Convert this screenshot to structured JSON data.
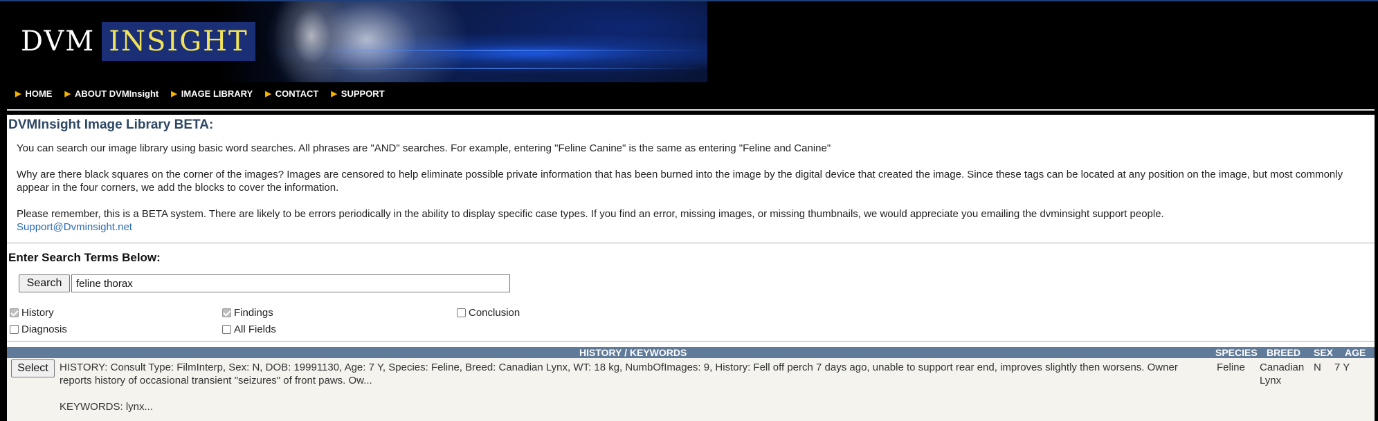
{
  "banner": {
    "logo_left": "DVM",
    "logo_right": "INSIGHT"
  },
  "nav": {
    "items": [
      {
        "label": "HOME"
      },
      {
        "label": "ABOUT DVMInsight"
      },
      {
        "label": "IMAGE LIBRARY"
      },
      {
        "label": "CONTACT"
      },
      {
        "label": "SUPPORT"
      }
    ]
  },
  "library": {
    "title": "DVMInsight Image Library BETA:",
    "para1": "You can search our image library using basic word searches. All phrases are \"AND\" searches.  For example, entering \"Feline Canine\" is the same as entering \"Feline and Canine\"",
    "para2": "Why are there black squares on the corner of the images? Images are censored to help eliminate possible private information that has been burned into the image by the digital device that created the image. Since these tags can be located at any position on the image, but most commonly appear in the four corners, we add the blocks to cover the information.",
    "para3": "Please remember, this is a BETA system. There are likely to be errors periodically in the ability to display specific case types.  If you find an error, missing images, or missing thumbnails, we would appreciate you emailing the dvminsight support people.",
    "support_link": "Support@Dvminsight.net"
  },
  "search": {
    "heading": "Enter Search Terms Below:",
    "button_label": "Search",
    "query": "feline thorax",
    "options": [
      {
        "label": "History",
        "checked": true
      },
      {
        "label": "Findings",
        "checked": true
      },
      {
        "label": "Conclusion",
        "checked": false
      },
      {
        "label": "Diagnosis",
        "checked": false
      },
      {
        "label": "All Fields",
        "checked": false
      }
    ]
  },
  "results": {
    "headers": {
      "history": "HISTORY / KEYWORDS",
      "species": "SPECIES",
      "breed": "BREED",
      "sex": "SEX",
      "age": "AGE"
    },
    "rows": [
      {
        "select_label": "Select",
        "history": "HISTORY: Consult Type: FilmInterp, Sex: N, DOB: 19991130, Age: 7 Y, Species: Feline, Breed: Canadian Lynx, WT: 18 kg, NumbOfImages: 9, History: Fell off perch 7 days ago, unable to support rear end, improves slightly then worsens. Owner reports history of occasional transient \"seizures\" of front paws. Ow...",
        "keywords": "KEYWORDS: lynx...",
        "species": "Feline",
        "breed": "Canadian Lynx",
        "sex": "N",
        "age": "7 Y"
      }
    ]
  }
}
